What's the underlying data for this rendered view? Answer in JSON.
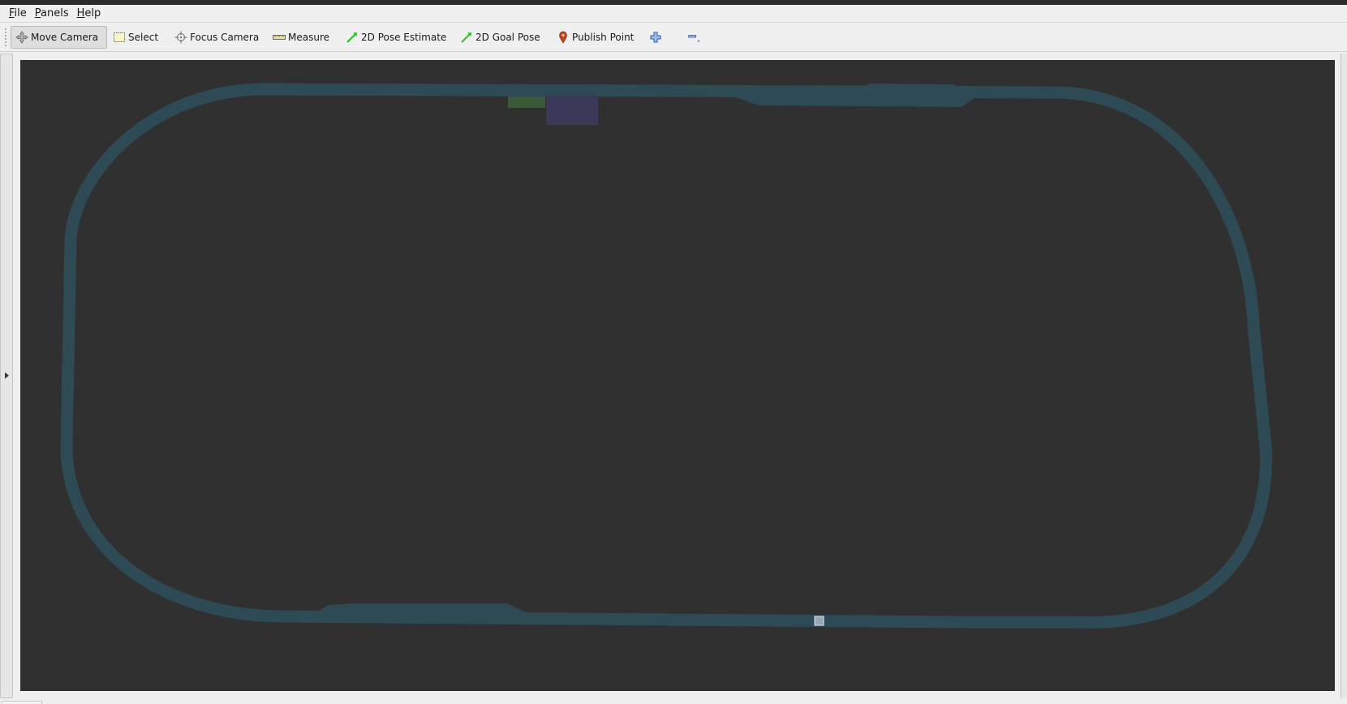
{
  "menu": {
    "file": {
      "mnemonic": "F",
      "rest": "ile"
    },
    "panels": {
      "mnemonic": "P",
      "rest": "anels"
    },
    "help": {
      "mnemonic": "H",
      "rest": "elp"
    }
  },
  "toolbar": {
    "move_camera": "Move Camera",
    "select": "Select",
    "focus_camera": "Focus Camera",
    "measure": "Measure",
    "pose_estimate": "2D Pose Estimate",
    "goal_pose": "2D Goal Pose",
    "publish_point": "Publish Point",
    "add_tool_icon": "plus-icon",
    "remove_tool_icon": "minus-icon",
    "active_tool": "Move Camera"
  },
  "viewport": {
    "background_color": "#303030",
    "track_color": "#2d4a55",
    "markers": [
      {
        "name": "green-marker",
        "color": "#3c5a3a"
      },
      {
        "name": "blue-marker",
        "color": "#3a3a58"
      },
      {
        "name": "small-box-marker",
        "color": "#9aa6b0"
      }
    ]
  }
}
